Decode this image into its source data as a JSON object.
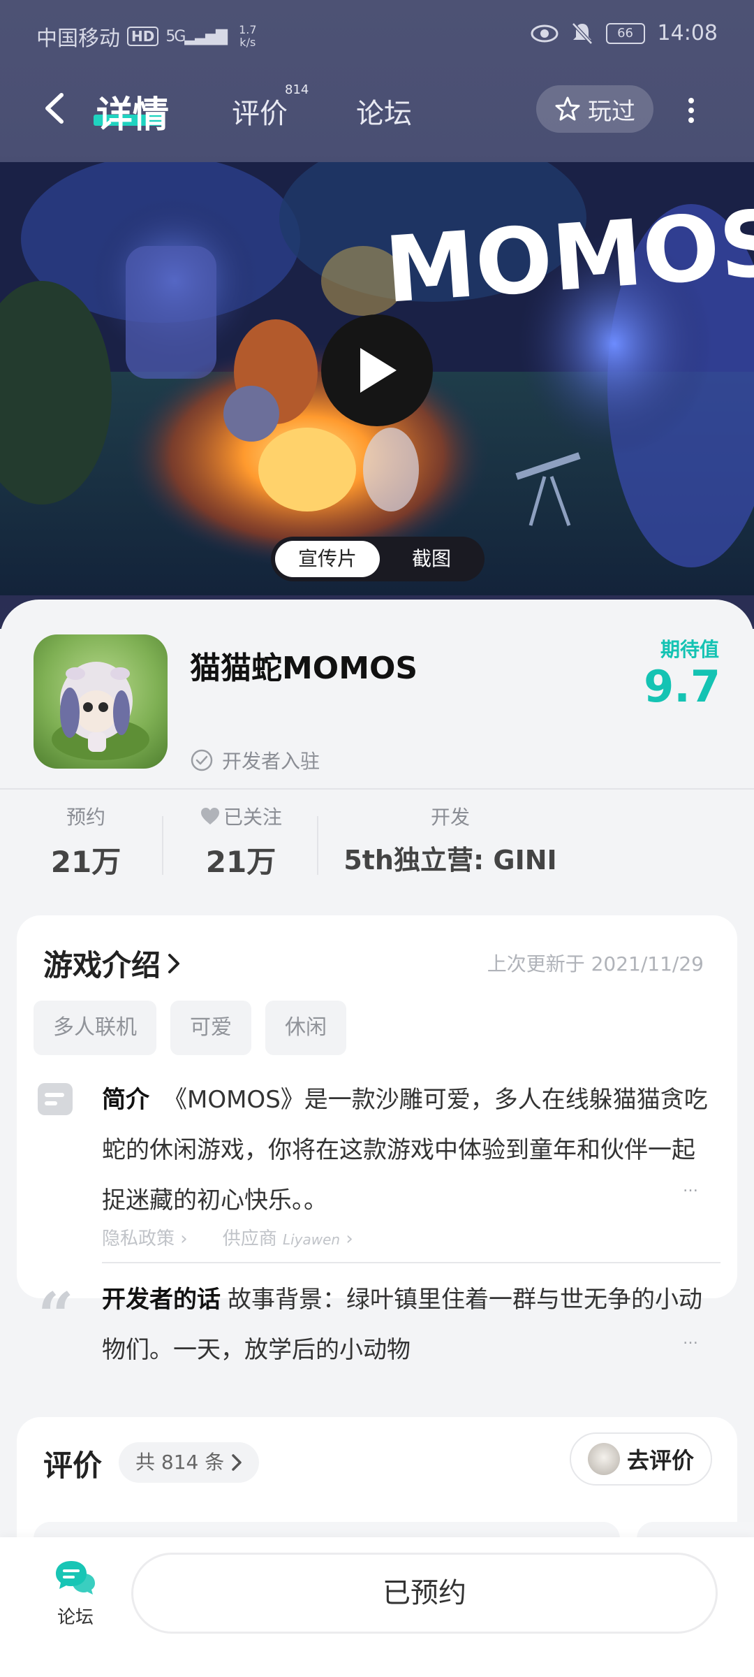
{
  "status_bar": {
    "carrier": "中国移动",
    "hd": "HD",
    "signal": "5G",
    "speed_value": "1.7",
    "speed_unit": "k/s",
    "battery": "66",
    "time": "14:08"
  },
  "nav": {
    "tab_detail": "详情",
    "tab_review": "评价",
    "tab_review_count": "814",
    "tab_forum": "论坛",
    "played_label": "玩过"
  },
  "media": {
    "logo_text": "MOMOS",
    "tab_video": "宣传片",
    "tab_screenshots": "截图"
  },
  "app": {
    "name": "猫猫蛇MOMOS",
    "verified_label": "开发者入驻",
    "expect_label": "期待值",
    "expect_value": "9.7"
  },
  "stats": {
    "reserve_label": "预约",
    "reserve_value": "21万",
    "follow_label": "已关注",
    "follow_value": "21万",
    "dev_label": "开发",
    "dev_value": "5th独立营: GINI"
  },
  "intro": {
    "title": "游戏介绍",
    "updated": "上次更新于 2021/11/29",
    "tags": [
      "多人联机",
      "可爱",
      "休闲"
    ],
    "desc_label": "简介",
    "desc_text": "《MOMOS》是一款沙雕可爱，多人在线躲猫猫贪吃蛇的休闲游戏，你将在这款游戏中体验到童年和伙伴一起捉迷藏的初心快乐。。",
    "more": "…",
    "privacy_link": "隐私政策",
    "vendor_label": "供应商",
    "vendor_name": "Liyawen",
    "dev_words_label": "开发者的话",
    "dev_words_text": "故事背景：绿叶镇里住着一群与世无争的小动物们。一天，放学后的小动物"
  },
  "review": {
    "title": "评价",
    "count": "共 814 条",
    "go_review": "去评价"
  },
  "bottom": {
    "forum_label": "论坛",
    "reserved_label": "已预约"
  },
  "colors": {
    "accent": "#14c3b3",
    "nav_underline": "#1fd3c0",
    "header_bg": "#4d5274"
  }
}
